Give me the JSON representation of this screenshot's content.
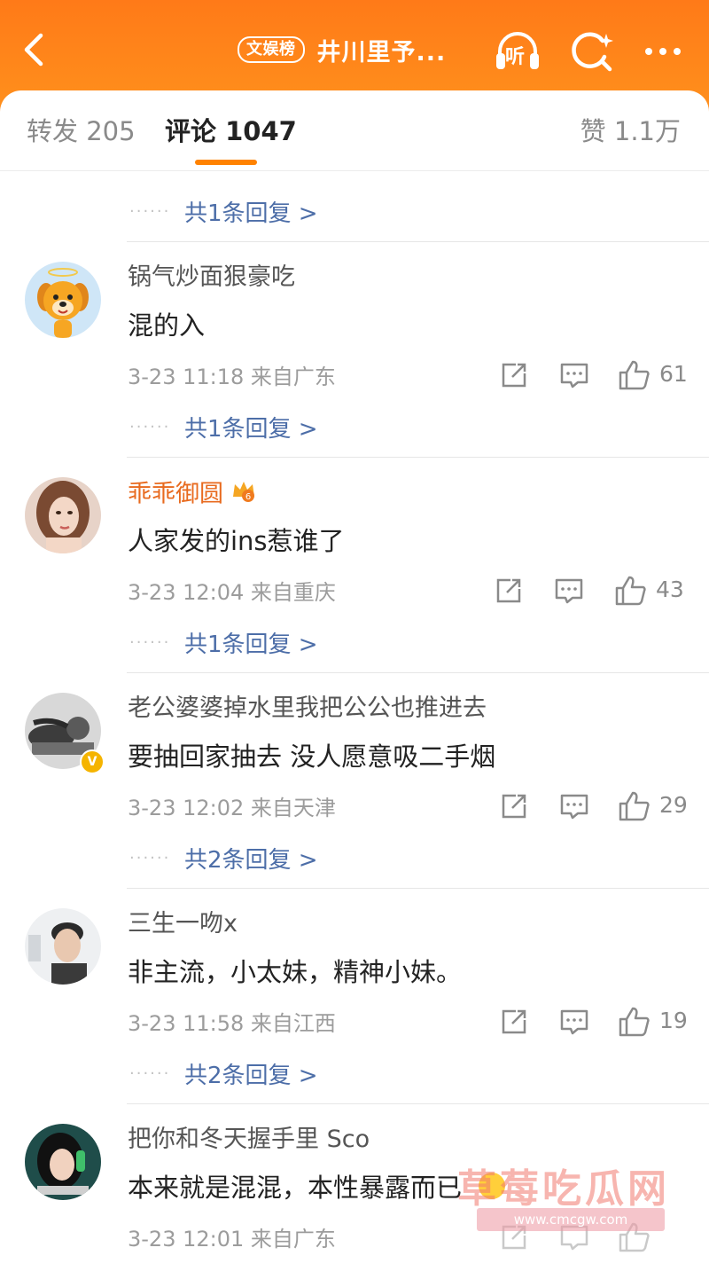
{
  "header": {
    "badge": "文娱榜",
    "title": "井川里予...",
    "listen_label": "听"
  },
  "tabs": {
    "repost": "转发 205",
    "comments": "评论 1047",
    "likes": "赞 1.1万"
  },
  "top_replies": "共1条回复 >",
  "comments": [
    {
      "username": "锅气炒面狠豪吃",
      "content": "混的入",
      "meta": "3-23 11:18  来自广东",
      "likes": "61",
      "replies": "共1条回复 >",
      "avatar": "cartoon-dog-avatar"
    },
    {
      "username": "乖乖御圆",
      "content": "人家发的ins惹谁了",
      "meta": "3-23 12:04  来自重庆",
      "likes": "43",
      "replies": "共1条回复 >",
      "avatar": "woman-photo-avatar",
      "vip_color": "#e86a1e"
    },
    {
      "username": "老公婆婆掉水里我把公公也推进去",
      "content": "要抽回家抽去 没人愿意吸二手烟",
      "meta": "3-23 12:02  来自天津",
      "likes": "29",
      "replies": "共2条回复 >",
      "avatar": "bw-man-photo-avatar",
      "verified": true
    },
    {
      "username": "三生一吻x",
      "content": "非主流，小太妹，精神小妹。",
      "meta": "3-23 11:58  来自江西",
      "likes": "19",
      "replies": "共2条回复 >",
      "avatar": "man-portrait-avatar"
    },
    {
      "username": "把你和冬天握手里 Sco",
      "content": "本来就是混混，本性暴露而已",
      "meta": "3-23 12:01  来自广东",
      "likes": "",
      "avatar": "anime-girl-avatar"
    }
  ],
  "watermark": {
    "text": "草莓吃瓜网",
    "url": "www.cmcgw.com"
  },
  "colors": {
    "brand_orange": "#ff8200",
    "link_blue": "#4d6ea8"
  }
}
